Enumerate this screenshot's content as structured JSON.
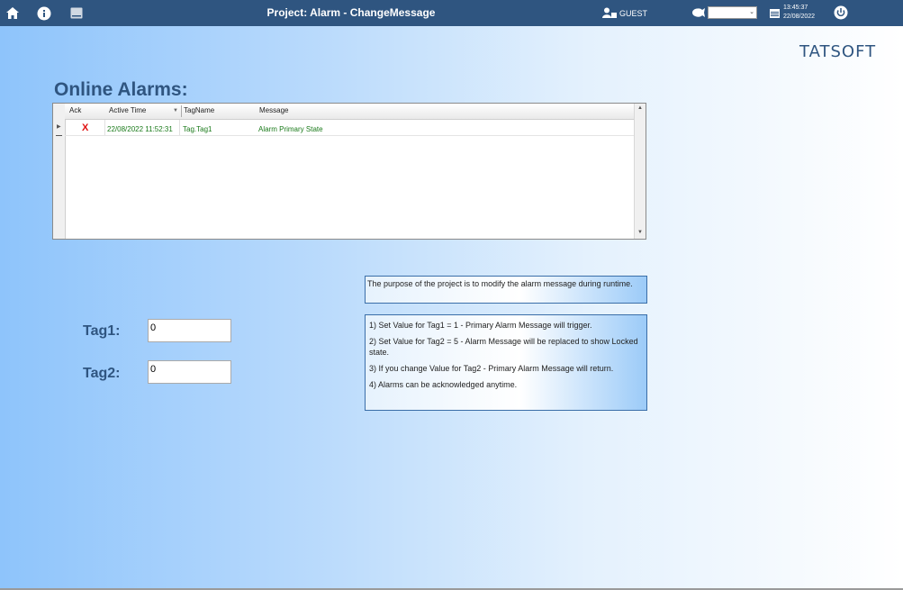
{
  "topbar": {
    "title": "Project: Alarm - ChangeMessage",
    "user": "GUEST",
    "time": "13:45:37",
    "date": "22/08/2022",
    "language_select": ""
  },
  "logo": "TATSOFT",
  "heading": "Online Alarms:",
  "alarm_grid": {
    "columns": [
      "Ack",
      "Active Time",
      "TagName",
      "Message"
    ],
    "rows": [
      {
        "ack": "X",
        "active_time": "22/08/2022 11:52:31",
        "tag_name": "Tag.Tag1",
        "message": "Alarm Primary State"
      }
    ]
  },
  "tags": [
    {
      "label": "Tag1:",
      "value": "0"
    },
    {
      "label": "Tag2:",
      "value": "0"
    }
  ],
  "purpose_note": "The purpose of the project is to modify the alarm message during runtime.",
  "instructions": [
    "1) Set Value for Tag1 = 1 - Primary Alarm Message will trigger.",
    "2) Set Value for Tag2 = 5 - Alarm Message will be replaced to show Locked state.",
    "3) If you change Value for Tag2 - Primary Alarm Message will return.",
    "4) Alarms can be acknowledged anytime."
  ]
}
